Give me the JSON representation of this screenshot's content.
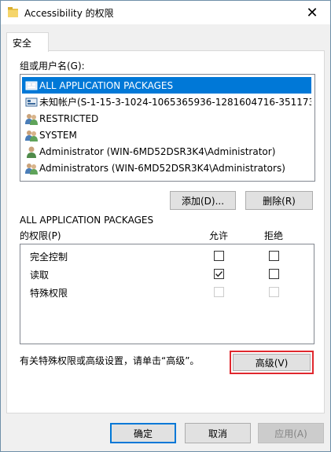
{
  "window": {
    "title": "Accessibility 的权限",
    "close_symbol": "✕"
  },
  "tabs": [
    {
      "label": "安全",
      "active": true
    }
  ],
  "group_label": "组或用户名(G):",
  "principals": [
    {
      "name": "ALL APPLICATION PACKAGES",
      "icon": "app-packages-icon",
      "selected": true
    },
    {
      "name": "未知帐户(S-1-15-3-1024-1065365936-1281604716-351173…",
      "icon": "unknown-account-icon",
      "selected": false
    },
    {
      "name": "RESTRICTED",
      "icon": "group-icon",
      "selected": false
    },
    {
      "name": "SYSTEM",
      "icon": "group-icon",
      "selected": false
    },
    {
      "name": "Administrator (WIN-6MD52DSR3K4\\Administrator)",
      "icon": "user-icon",
      "selected": false
    },
    {
      "name": "Administrators (WIN-6MD52DSR3K4\\Administrators)",
      "icon": "group-icon",
      "selected": false
    }
  ],
  "buttons": {
    "add": "添加(D)...",
    "remove": "删除(R)",
    "advanced": "高级(V)",
    "ok": "确定",
    "cancel": "取消",
    "apply": "应用(A)"
  },
  "permissions": {
    "for_label_line1": "ALL APPLICATION PACKAGES",
    "for_label_line2": "的权限(P)",
    "allow_header": "允许",
    "deny_header": "拒绝",
    "rows": [
      {
        "label": "完全控制",
        "allow": false,
        "deny": false,
        "enabled": true
      },
      {
        "label": "读取",
        "allow": true,
        "deny": false,
        "enabled": true
      },
      {
        "label": "特殊权限",
        "allow": false,
        "deny": false,
        "enabled": false
      }
    ]
  },
  "advanced_hint": "有关特殊权限或高级设置，请单击“高级”。",
  "colors": {
    "selection": "#0078d7",
    "highlight_border": "#e0282e",
    "folder": "#e8c34a"
  }
}
